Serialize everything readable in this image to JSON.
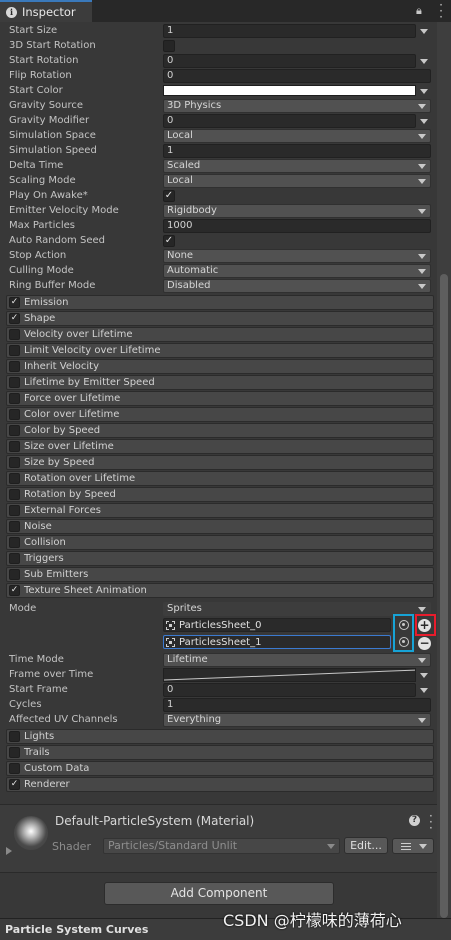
{
  "tab": {
    "title": "Inspector"
  },
  "properties": [
    {
      "label": "Start Size",
      "kind": "field-arrow",
      "value": "1"
    },
    {
      "label": "3D Start Rotation",
      "kind": "check",
      "value": ""
    },
    {
      "label": "Start Rotation",
      "kind": "field-arrow",
      "value": "0"
    },
    {
      "label": "Flip Rotation",
      "kind": "field",
      "value": "0"
    },
    {
      "label": "Start Color",
      "kind": "color",
      "value": "#FFFFFF"
    },
    {
      "label": "Gravity Source",
      "kind": "dropdown",
      "value": "3D Physics"
    },
    {
      "label": "Gravity Modifier",
      "kind": "field-arrow",
      "value": "0"
    },
    {
      "label": "Simulation Space",
      "kind": "dropdown",
      "value": "Local"
    },
    {
      "label": "Simulation Speed",
      "kind": "field",
      "value": "1"
    },
    {
      "label": "Delta Time",
      "kind": "dropdown",
      "value": "Scaled"
    },
    {
      "label": "Scaling Mode",
      "kind": "dropdown",
      "value": "Local"
    },
    {
      "label": "Play On Awake*",
      "kind": "check",
      "value": "✓"
    },
    {
      "label": "Emitter Velocity Mode",
      "kind": "dropdown",
      "value": "Rigidbody"
    },
    {
      "label": "Max Particles",
      "kind": "field",
      "value": "1000"
    },
    {
      "label": "Auto Random Seed",
      "kind": "check",
      "value": "✓"
    },
    {
      "label": "Stop Action",
      "kind": "dropdown",
      "value": "None"
    },
    {
      "label": "Culling Mode",
      "kind": "dropdown",
      "value": "Automatic"
    },
    {
      "label": "Ring Buffer Mode",
      "kind": "dropdown",
      "value": "Disabled"
    }
  ],
  "modules": [
    {
      "label": "Emission",
      "check": "✓"
    },
    {
      "label": "Shape",
      "check": "✓"
    },
    {
      "label": "Velocity over Lifetime",
      "check": ""
    },
    {
      "label": "Limit Velocity over Lifetime",
      "check": ""
    },
    {
      "label": "Inherit Velocity",
      "check": ""
    },
    {
      "label": "Lifetime by Emitter Speed",
      "check": ""
    },
    {
      "label": "Force over Lifetime",
      "check": ""
    },
    {
      "label": "Color over Lifetime",
      "check": ""
    },
    {
      "label": "Color by Speed",
      "check": ""
    },
    {
      "label": "Size over Lifetime",
      "check": ""
    },
    {
      "label": "Size by Speed",
      "check": ""
    },
    {
      "label": "Rotation over Lifetime",
      "check": ""
    },
    {
      "label": "Rotation by Speed",
      "check": ""
    },
    {
      "label": "External Forces",
      "check": ""
    },
    {
      "label": "Noise",
      "check": ""
    },
    {
      "label": "Collision",
      "check": ""
    },
    {
      "label": "Triggers",
      "check": ""
    },
    {
      "label": "Sub Emitters",
      "check": ""
    },
    {
      "label": "Texture Sheet Animation",
      "check": "✓"
    }
  ],
  "texture_sheet": {
    "mode_label": "Mode",
    "mode_value": "Sprites",
    "sprites": [
      "ParticlesSheet_0",
      "ParticlesSheet_1"
    ],
    "props": [
      {
        "label": "Time Mode",
        "kind": "dropdown",
        "value": "Lifetime"
      },
      {
        "label": "Frame over Time",
        "kind": "curve",
        "value": ""
      },
      {
        "label": "Start Frame",
        "kind": "field-arrow",
        "value": "0"
      },
      {
        "label": "Cycles",
        "kind": "field",
        "value": "1"
      },
      {
        "label": "Affected UV Channels",
        "kind": "dropdown",
        "value": "Everything"
      }
    ]
  },
  "modules_after": [
    {
      "label": "Lights",
      "check": ""
    },
    {
      "label": "Trails",
      "check": ""
    },
    {
      "label": "Custom Data",
      "check": ""
    },
    {
      "label": "Renderer",
      "check": "✓"
    }
  ],
  "material": {
    "title": "Default-ParticleSystem (Material)",
    "help": "?",
    "shader_label": "Shader",
    "shader_value": "Particles/Standard Unlit",
    "edit_label": "Edit..."
  },
  "add_component": "Add Component",
  "curves_title": "Particle System Curves",
  "watermark": "CSDN @柠檬味的薄荷心",
  "colors": {
    "accent": "#3a79bb",
    "highlight_cyan": "#17a3d6",
    "highlight_red": "#e81c2c"
  }
}
